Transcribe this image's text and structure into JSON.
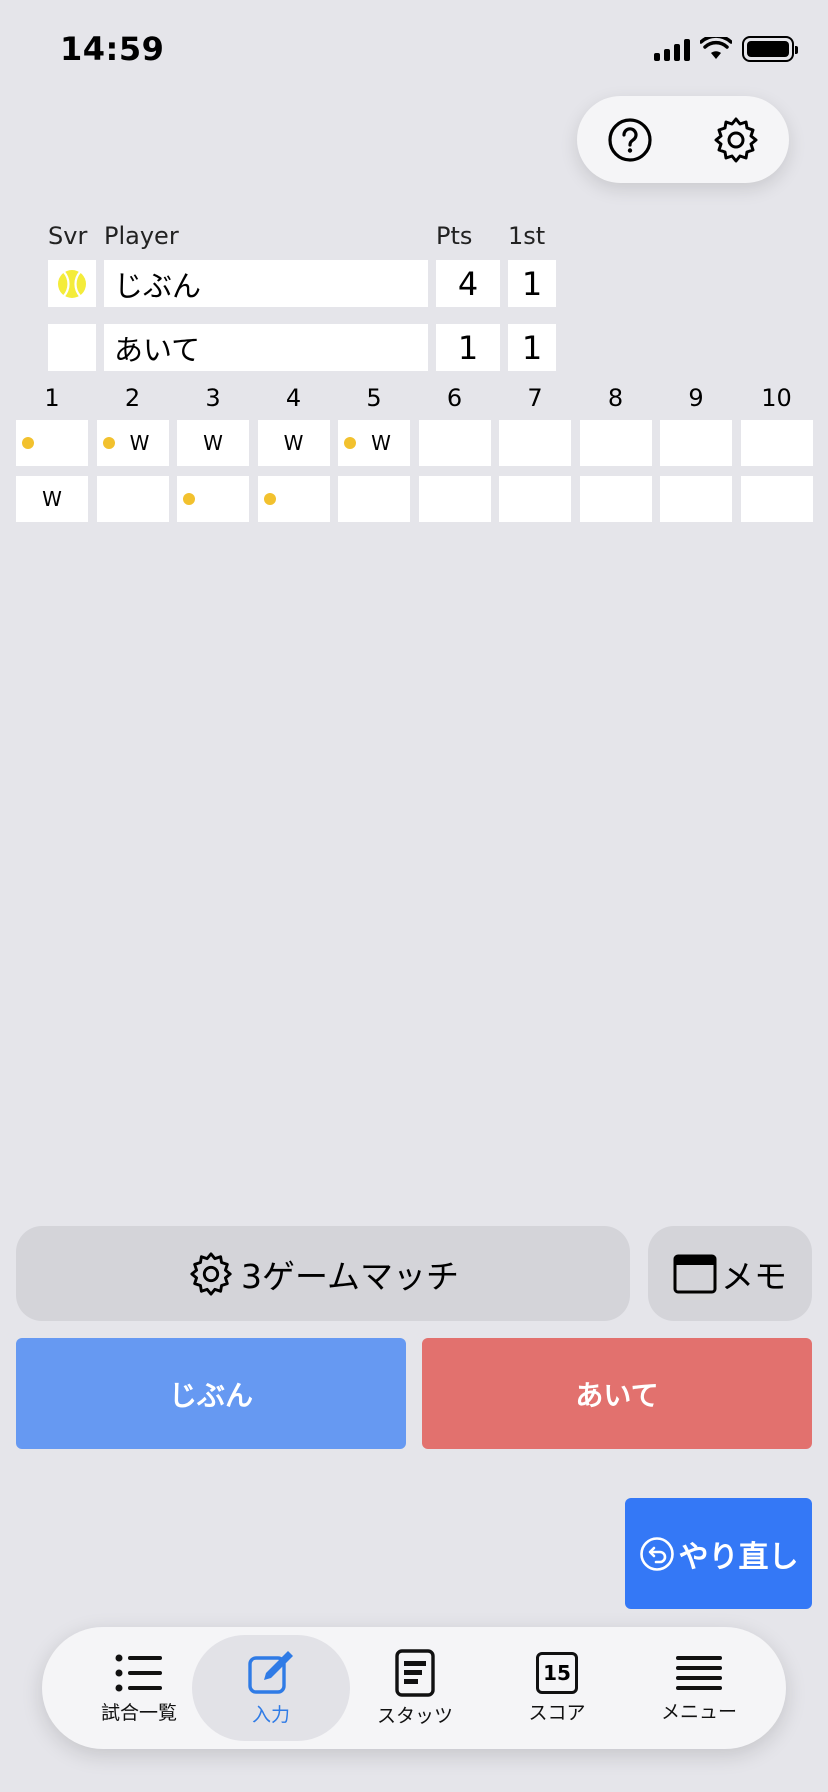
{
  "status": {
    "time": "14:59"
  },
  "top_actions": {
    "help_icon": "help-circle-icon",
    "settings_icon": "gear-icon"
  },
  "score": {
    "headers": {
      "server": "Svr",
      "player": "Player",
      "points": "Pts",
      "set1": "1st"
    },
    "players": [
      {
        "name": "じぶん",
        "serving": true,
        "points": "4",
        "set1": "1"
      },
      {
        "name": "あいて",
        "serving": false,
        "points": "1",
        "set1": "1"
      }
    ]
  },
  "games": {
    "columns": [
      "1",
      "2",
      "3",
      "4",
      "5",
      "6",
      "7",
      "8",
      "9",
      "10"
    ],
    "rows": [
      [
        {
          "serve": true,
          "w": ""
        },
        {
          "serve": true,
          "w": "W"
        },
        {
          "serve": false,
          "w": "W"
        },
        {
          "serve": false,
          "w": "W"
        },
        {
          "serve": true,
          "w": "W"
        },
        {},
        {},
        {},
        {},
        {}
      ],
      [
        {
          "serve": false,
          "w": "W"
        },
        {},
        {
          "serve": true,
          "w": ""
        },
        {
          "serve": true,
          "w": ""
        },
        {},
        {},
        {},
        {},
        {},
        {}
      ]
    ]
  },
  "controls": {
    "match_label": "3ゲームマッチ",
    "memo_label": "メモ",
    "player1_button": "じぶん",
    "player2_button": "あいて",
    "undo_label": "やり直し",
    "colors": {
      "player1": "#6699f2",
      "player2": "#e2716e",
      "undo": "#3478f6",
      "serve_dot": "#f2c12e"
    }
  },
  "tabbar": {
    "tabs": [
      {
        "label": "試合一覧",
        "icon": "list-icon",
        "active": false
      },
      {
        "label": "入力",
        "icon": "edit-icon",
        "active": true
      },
      {
        "label": "スタッツ",
        "icon": "stats-doc-icon",
        "active": false
      },
      {
        "label": "スコア",
        "icon": "calendar-15-icon",
        "active": false,
        "icon_text": "15"
      },
      {
        "label": "メニュー",
        "icon": "menu-icon",
        "active": false
      }
    ]
  }
}
